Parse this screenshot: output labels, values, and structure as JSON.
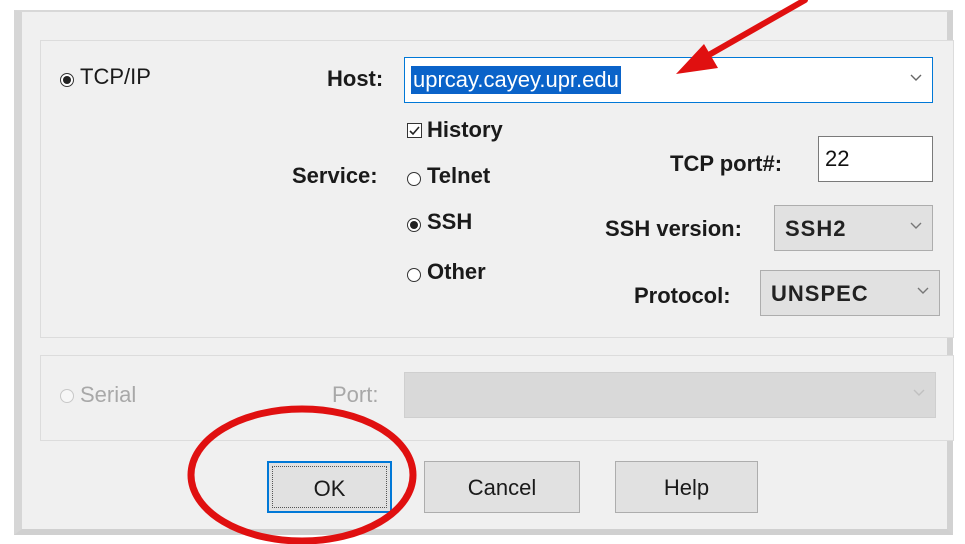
{
  "tcpip": {
    "label": "TCP/IP",
    "selected": true
  },
  "host": {
    "label": "Host:",
    "value": "uprcay.cayey.upr.edu"
  },
  "history": {
    "label": "History",
    "checked": true
  },
  "service": {
    "label": "Service:",
    "options": [
      {
        "label": "Telnet",
        "selected": false
      },
      {
        "label": "SSH",
        "selected": true
      },
      {
        "label": "Other",
        "selected": false
      }
    ]
  },
  "tcp_port": {
    "label": "TCP port#:",
    "value": "22"
  },
  "ssh_version": {
    "label": "SSH version:",
    "value": "SSH2"
  },
  "protocol": {
    "label": "Protocol:",
    "value": "UNSPEC"
  },
  "serial": {
    "label": "Serial",
    "enabled": false
  },
  "port": {
    "label": "Port:",
    "value": ""
  },
  "buttons": {
    "ok": "OK",
    "cancel": "Cancel",
    "help": "Help"
  },
  "annotations": {
    "color": "#e01010"
  },
  "icons": {
    "dropdown": "chevron-down-icon",
    "check": "check-icon",
    "arrow": "red-arrow-icon",
    "ellipse": "red-ellipse-highlight"
  }
}
